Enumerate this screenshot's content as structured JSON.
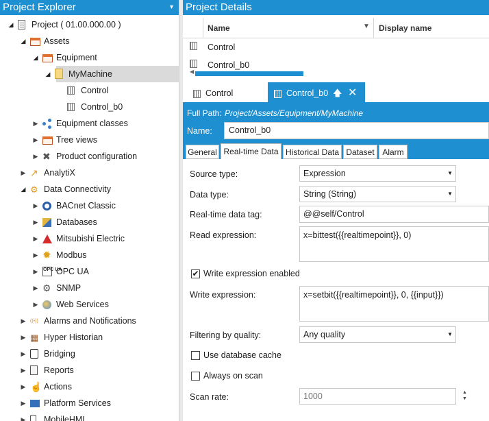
{
  "explorer": {
    "title": "Project Explorer",
    "pin_glyph": "▾",
    "tree": [
      {
        "label": "Project ( 01.00.000.00 )",
        "icon": "project-icon",
        "depth": 0,
        "expander": "open"
      },
      {
        "label": "Assets",
        "icon": "assets-icon",
        "depth": 1,
        "expander": "open"
      },
      {
        "label": "Equipment",
        "icon": "equipment-icon",
        "depth": 2,
        "expander": "open"
      },
      {
        "label": "MyMachine",
        "icon": "folder-icon",
        "depth": 3,
        "expander": "open",
        "selected": true
      },
      {
        "label": "Control",
        "icon": "tag-icon",
        "depth": 4,
        "expander": "none"
      },
      {
        "label": "Control_b0",
        "icon": "tag-icon",
        "depth": 4,
        "expander": "none"
      },
      {
        "label": "Equipment classes",
        "icon": "equipment-classes-icon",
        "depth": 2,
        "expander": "closed"
      },
      {
        "label": "Tree views",
        "icon": "tree-views-icon",
        "depth": 2,
        "expander": "closed"
      },
      {
        "label": "Product configuration",
        "icon": "tools-icon",
        "depth": 2,
        "expander": "closed"
      },
      {
        "label": "AnalytiX",
        "icon": "analytix-icon",
        "depth": 1,
        "expander": "closed"
      },
      {
        "label": "Data Connectivity",
        "icon": "data-connectivity-icon",
        "depth": 1,
        "expander": "open"
      },
      {
        "label": "BACnet Classic",
        "icon": "bacnet-icon",
        "depth": 2,
        "expander": "closed"
      },
      {
        "label": "Databases",
        "icon": "databases-icon",
        "depth": 2,
        "expander": "closed"
      },
      {
        "label": "Mitsubishi Electric",
        "icon": "mitsubishi-icon",
        "depth": 2,
        "expander": "closed"
      },
      {
        "label": "Modbus",
        "icon": "modbus-icon",
        "depth": 2,
        "expander": "closed"
      },
      {
        "label": "OPC UA",
        "icon": "opc-ua-icon",
        "depth": 2,
        "expander": "closed"
      },
      {
        "label": "SNMP",
        "icon": "snmp-icon",
        "depth": 2,
        "expander": "closed"
      },
      {
        "label": "Web Services",
        "icon": "web-services-icon",
        "depth": 2,
        "expander": "closed"
      },
      {
        "label": "Alarms and Notifications",
        "icon": "alarms-icon",
        "depth": 1,
        "expander": "closed"
      },
      {
        "label": "Hyper Historian",
        "icon": "hyper-historian-icon",
        "depth": 1,
        "expander": "closed"
      },
      {
        "label": "Bridging",
        "icon": "bridging-icon",
        "depth": 1,
        "expander": "closed"
      },
      {
        "label": "Reports",
        "icon": "reports-icon",
        "depth": 1,
        "expander": "closed"
      },
      {
        "label": "Actions",
        "icon": "actions-icon",
        "depth": 1,
        "expander": "closed"
      },
      {
        "label": "Platform Services",
        "icon": "platform-services-icon",
        "depth": 1,
        "expander": "closed"
      },
      {
        "label": "MobileHMI",
        "icon": "mobilehmi-icon",
        "depth": 1,
        "expander": "closed"
      }
    ]
  },
  "details": {
    "title": "Project Details",
    "columns": {
      "name": "Name",
      "display_name": "Display name"
    },
    "rows": [
      "Control",
      "Control_b0"
    ]
  },
  "doc_tabs": [
    {
      "label": "Control",
      "active": false
    },
    {
      "label": "Control_b0",
      "active": true,
      "pin_glyph": "🡅",
      "close_glyph": "✕"
    }
  ],
  "info": {
    "full_path_label": "Full Path:",
    "full_path_value": "Project/Assets/Equipment/MyMachine",
    "name_label": "Name:",
    "name_value": "Control_b0"
  },
  "prop_tabs": [
    {
      "label": "General",
      "active": false
    },
    {
      "label": "Real-time Data",
      "active": true
    },
    {
      "label": "Historical Data",
      "active": false
    },
    {
      "label": "Dataset",
      "active": false
    },
    {
      "label": "Alarm",
      "active": false
    }
  ],
  "form": {
    "source_type_label": "Source type:",
    "source_type_value": "Expression",
    "data_type_label": "Data type:",
    "data_type_value": "String (String)",
    "rt_tag_label": "Real-time data tag:",
    "rt_tag_value": "@@self/Control",
    "read_expr_label": "Read expression:",
    "read_expr_value": "x=bittest({{realtimepoint}}, 0)",
    "write_enabled_label": "Write expression enabled",
    "write_enabled_checked": true,
    "write_expr_label": "Write expression:",
    "write_expr_value": "x=setbit({{realtimepoint}}, 0, {{input}})",
    "filter_label": "Filtering by quality:",
    "filter_value": "Any quality",
    "db_cache_label": "Use database cache",
    "db_cache_checked": false,
    "always_scan_label": "Always on scan",
    "always_scan_checked": false,
    "scan_rate_label": "Scan rate:",
    "scan_rate_value": "1000"
  },
  "colors": {
    "accent": "#1e8fd1",
    "selected_row": "#dadada"
  }
}
